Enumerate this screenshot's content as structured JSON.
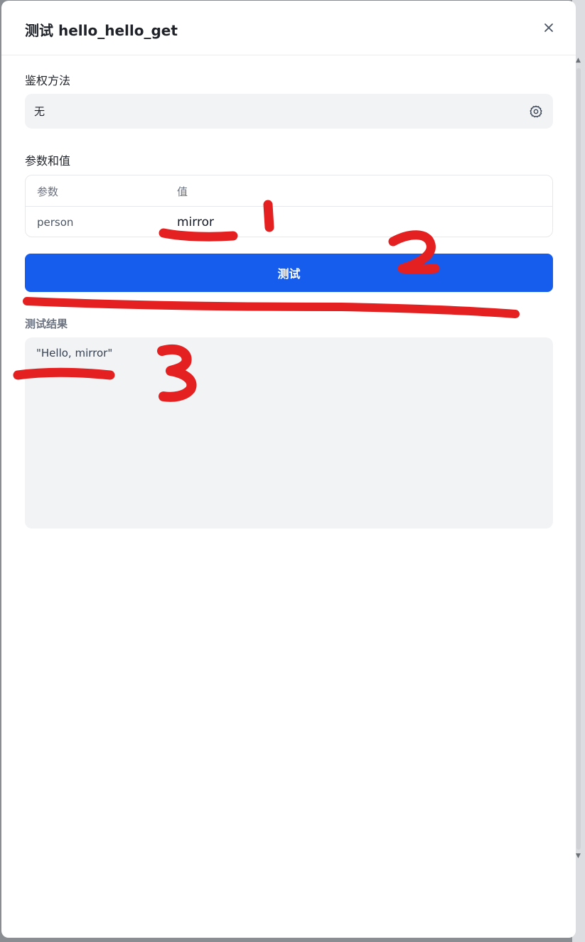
{
  "dialog": {
    "title": "测试 hello_hello_get"
  },
  "auth": {
    "label": "鉴权方法",
    "value": "无"
  },
  "params": {
    "label": "参数和值",
    "columns": [
      "参数",
      "值"
    ],
    "rows": [
      {
        "name": "person",
        "value": "mirror"
      }
    ]
  },
  "test_button": {
    "label": "测试"
  },
  "result": {
    "label": "测试结果",
    "text": "\"Hello, mirror\""
  },
  "annotations": {
    "color": "#e42020",
    "marks": [
      "1",
      "2",
      "3"
    ]
  },
  "colors": {
    "primary": "#165dee",
    "field_bg": "#f2f3f5"
  }
}
